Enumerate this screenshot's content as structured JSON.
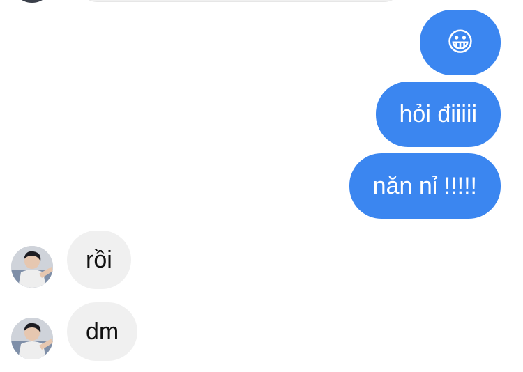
{
  "messages": [
    {
      "direction": "outgoing",
      "type": "emoji",
      "emoji_name": "grinning-face-emoji",
      "text": "😀"
    },
    {
      "direction": "outgoing",
      "type": "text",
      "text": "hỏi điiiii"
    },
    {
      "direction": "outgoing",
      "type": "text",
      "text": "năn nỉ !!!!!"
    },
    {
      "direction": "incoming",
      "type": "text",
      "text": "rồi",
      "has_avatar": true
    },
    {
      "direction": "incoming",
      "type": "text",
      "text": "dm",
      "has_avatar": true
    }
  ],
  "colors": {
    "outgoing_bubble": "#3b86f0",
    "outgoing_text": "#ffffff",
    "incoming_bubble": "#f0f0f0",
    "incoming_text": "#111111",
    "background": "#ffffff"
  }
}
